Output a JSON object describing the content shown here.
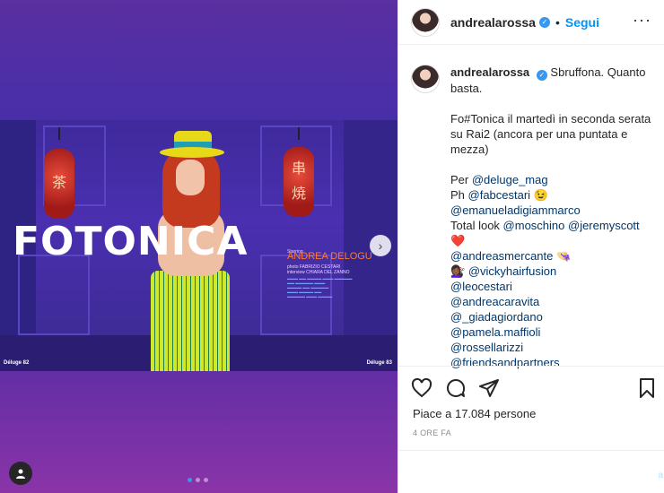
{
  "post": {
    "author": "andrealarossa",
    "follow_label": "Segui",
    "separator": "•",
    "more_label": "···",
    "caption_lines": [
      "Sbruffona. Quanto basta.",
      "",
      "Fo#Tonica il martedì in seconda serata su Rai2 (ancora per una puntata e mezza)"
    ],
    "credits": [
      {
        "prefix": "Per ",
        "handle": "@deluge_mag",
        "suffix": ""
      },
      {
        "prefix": "Ph ",
        "handle": "@fabcestari",
        "suffix": " 😉"
      },
      {
        "prefix": "",
        "handle": "@emanueladigiammarco",
        "suffix": ""
      },
      {
        "prefix": "Total look ",
        "handle": "@moschino @jeremyscott",
        "suffix": " ❤️"
      },
      {
        "prefix": "",
        "handle": "@andreasmercante",
        "suffix": " 👒"
      },
      {
        "prefix": "💇🏾‍♀️ ",
        "handle": "@vickyhairfusion",
        "suffix": ""
      },
      {
        "prefix": "",
        "handle": "@leocestari",
        "suffix": ""
      },
      {
        "prefix": "",
        "handle": "@andreacaravita",
        "suffix": ""
      },
      {
        "prefix": "",
        "handle": "@_giadagiordano",
        "suffix": ""
      },
      {
        "prefix": "",
        "handle": "@pamela.maffioli",
        "suffix": ""
      },
      {
        "prefix": "",
        "handle": "@rossellarizzi",
        "suffix": ""
      },
      {
        "prefix": "",
        "handle": "@friendsandpartners",
        "suffix": ""
      }
    ],
    "likes_text": "Piace a 17.084 persone",
    "time_text": "4 ORE FA",
    "comment_hint": "a"
  },
  "media": {
    "headline": "FOTONICA",
    "starring_name": "ANDREA DELOGU",
    "starring_prefix": "Starring",
    "photo_credit": "photo FABRIZIO CESTARI",
    "interview_credit": "interview CHIARA DEL ZANNO",
    "left_page": "Déluge 82",
    "right_page": "Déluge 83",
    "lantern_glyph_left": "茶",
    "lantern_glyph_right_1": "串",
    "lantern_glyph_right_2": "焼",
    "carousel_count": 3,
    "carousel_active": 0
  },
  "colors": {
    "link": "#00376b",
    "follow": "#0095f6",
    "verified": "#3897f0"
  }
}
